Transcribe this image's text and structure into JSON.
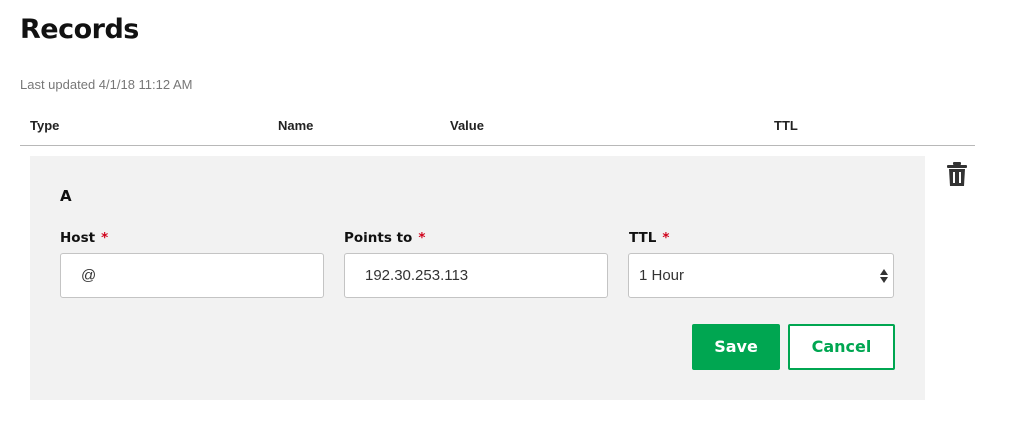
{
  "page": {
    "title": "Records",
    "last_updated": "Last updated 4/1/18 11:12 AM"
  },
  "table": {
    "columns": [
      "Type",
      "Name",
      "Value",
      "TTL"
    ]
  },
  "record": {
    "type": "A",
    "host": {
      "label": "Host",
      "required_mark": "*",
      "value": "@"
    },
    "points_to": {
      "label": "Points to",
      "required_mark": "*",
      "value": "192.30.253.113"
    },
    "ttl": {
      "label": "TTL",
      "required_mark": "*",
      "selected": "1 Hour"
    },
    "save_label": "Save",
    "cancel_label": "Cancel",
    "delete_icon": "trash-icon"
  },
  "colors": {
    "accent": "#00a651",
    "required": "#d0021b",
    "panel_bg": "#f2f2f2"
  }
}
